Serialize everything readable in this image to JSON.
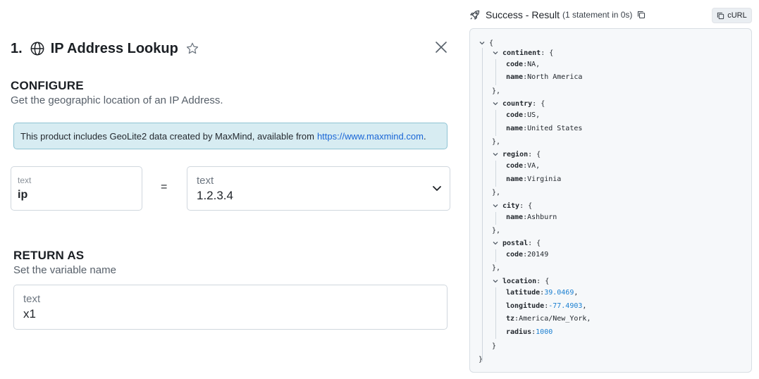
{
  "step": {
    "number": "1.",
    "title": "IP Address Lookup"
  },
  "configure": {
    "title": "CONFIGURE",
    "subtitle": "Get the geographic location of an IP Address."
  },
  "notice": {
    "text": "This product includes GeoLite2 data created by MaxMind, available from",
    "link_text": "https://www.maxmind.com",
    "suffix": "."
  },
  "input": {
    "name_label": "text",
    "name_value": "ip",
    "equals": "=",
    "value_label": "text",
    "value_value": "1.2.3.4"
  },
  "return_as": {
    "title": "RETURN AS",
    "subtitle": "Set the variable name",
    "field_label": "text",
    "field_value": "x1"
  },
  "result": {
    "title": "Success - Result",
    "meta": "(1 statement in 0s)",
    "curl_label": "cURL"
  },
  "json": {
    "open": "{",
    "close": "}",
    "continent": {
      "key": "continent",
      "code": "NA",
      "name": "North America"
    },
    "country": {
      "key": "country",
      "code": "US",
      "name": "United States"
    },
    "region": {
      "key": "region",
      "code": "VA",
      "name": "Virginia"
    },
    "city": {
      "key": "city",
      "name": "Ashburn"
    },
    "postal": {
      "key": "postal",
      "code": "20149"
    },
    "location": {
      "key": "location",
      "latitude": "39.0469",
      "longitude": "-77.4903",
      "tz": "America/New_York",
      "radius": "1000"
    },
    "labels": {
      "code": "code",
      "name": "name",
      "latitude": "latitude",
      "longitude": "longitude",
      "tz": "tz",
      "radius": "radius"
    }
  },
  "colors": {
    "accent_link": "#1a66d6",
    "notice_bg": "#d7ecf2",
    "json_number": "#1a7fd1"
  }
}
